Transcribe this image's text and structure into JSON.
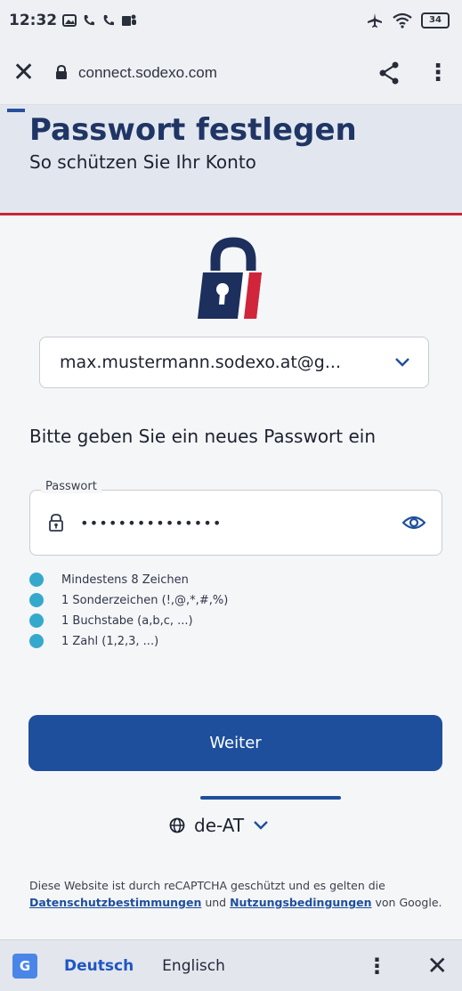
{
  "status_bar": {
    "time": "12:32",
    "battery": "34"
  },
  "browser": {
    "url": "connect.sodexo.com",
    "close_glyph": "✕",
    "menu_glyph": "⋮"
  },
  "header": {
    "title": "Passwort festlegen",
    "subtitle": "So schützen Sie Ihr Konto"
  },
  "account": {
    "selected": "max.mustermann.sodexo.at@g..."
  },
  "form": {
    "prompt": "Bitte geben Sie ein neues Passwort ein",
    "password_label": "Passwort",
    "password_value": "•••••••••••••••"
  },
  "requirements": [
    {
      "text": "Mindestens 8 Zeichen",
      "met": true
    },
    {
      "text": "1 Sonderzeichen (!,@,*,#,%)",
      "met": true
    },
    {
      "text": "1 Buchstabe (a,b,c, ...)",
      "met": true
    },
    {
      "text": "1 Zahl (1,2,3, ...)",
      "met": true
    }
  ],
  "actions": {
    "next_label": "Weiter"
  },
  "language": {
    "selected": "de-AT"
  },
  "legal": {
    "text_before": "Diese Website ist durch reCAPTCHA geschützt und es gelten die ",
    "privacy_link": "Datenschutzbestimmungen",
    "middle": " und ",
    "terms_link": "Nutzungsbedingungen",
    "text_after": " von Google."
  },
  "translate_bar": {
    "source_lang": "Deutsch",
    "target_lang": "Englisch",
    "menu_glyph": "⋮",
    "close_glyph": "✕"
  },
  "icons": {
    "status_left": [
      "picture-icon",
      "phone-icon",
      "phone-icon",
      "teams-icon"
    ],
    "status_right": [
      "airplane-icon",
      "wifi-icon",
      "battery-icon"
    ]
  },
  "colors": {
    "primary": "#1e4f9d",
    "accent_red": "#c92537",
    "check": "#35a9cc"
  }
}
